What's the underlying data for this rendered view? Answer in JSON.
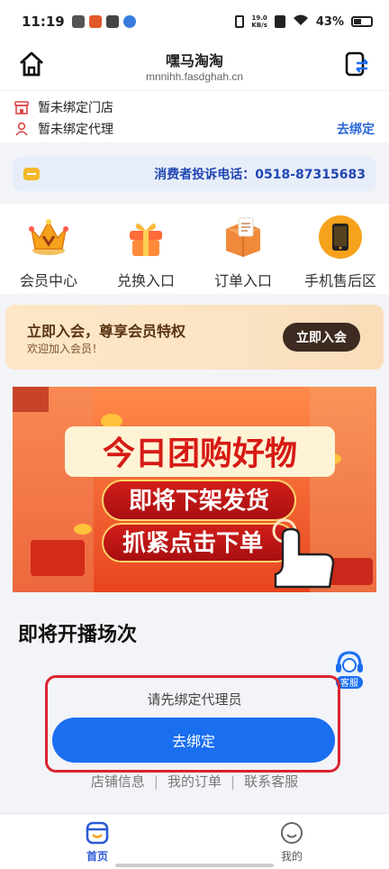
{
  "status_bar": {
    "time": "11:19",
    "net_speed_value": "19.0",
    "net_speed_unit": "KB/s",
    "battery": "43%"
  },
  "header": {
    "title": "嘿马淘淘",
    "subtitle": "mnnihh.fasdghah.cn"
  },
  "binding": {
    "store_status": "暂未绑定门店",
    "agent_status": "暂未绑定代理",
    "bind_link": "去绑定"
  },
  "complaint": {
    "phone_text": "消费者投诉电话：0518-87315683"
  },
  "quick_nav": [
    {
      "label": "会员中心",
      "icon": "crown-icon"
    },
    {
      "label": "兑换入口",
      "icon": "gift-icon"
    },
    {
      "label": "订单入口",
      "icon": "order-box-icon"
    },
    {
      "label": "手机售后区",
      "icon": "phone-icon"
    }
  ],
  "member_banner": {
    "headline": "立即入会，尊享会员特权",
    "subtext": "欢迎加入会员！",
    "button": "立即入会"
  },
  "promo_banner": {
    "line1": "今日团购好物",
    "line2": "即将下架发货",
    "line3": "抓紧点击下单"
  },
  "section_title": "即将开播场次",
  "customer_service": {
    "label": "客服"
  },
  "bind_prompt": {
    "message": "请先绑定代理员",
    "button": "去绑定"
  },
  "footer_links": [
    "店铺信息",
    "我的订单",
    "联系客服"
  ],
  "tabs": [
    {
      "label": "首页",
      "active": true
    },
    {
      "label": "我的",
      "active": false
    }
  ],
  "colors": {
    "accent_blue": "#1a6ef0",
    "link_blue": "#2b66d9",
    "highlight_red": "#d92331",
    "member_dark": "#3d2a20"
  }
}
